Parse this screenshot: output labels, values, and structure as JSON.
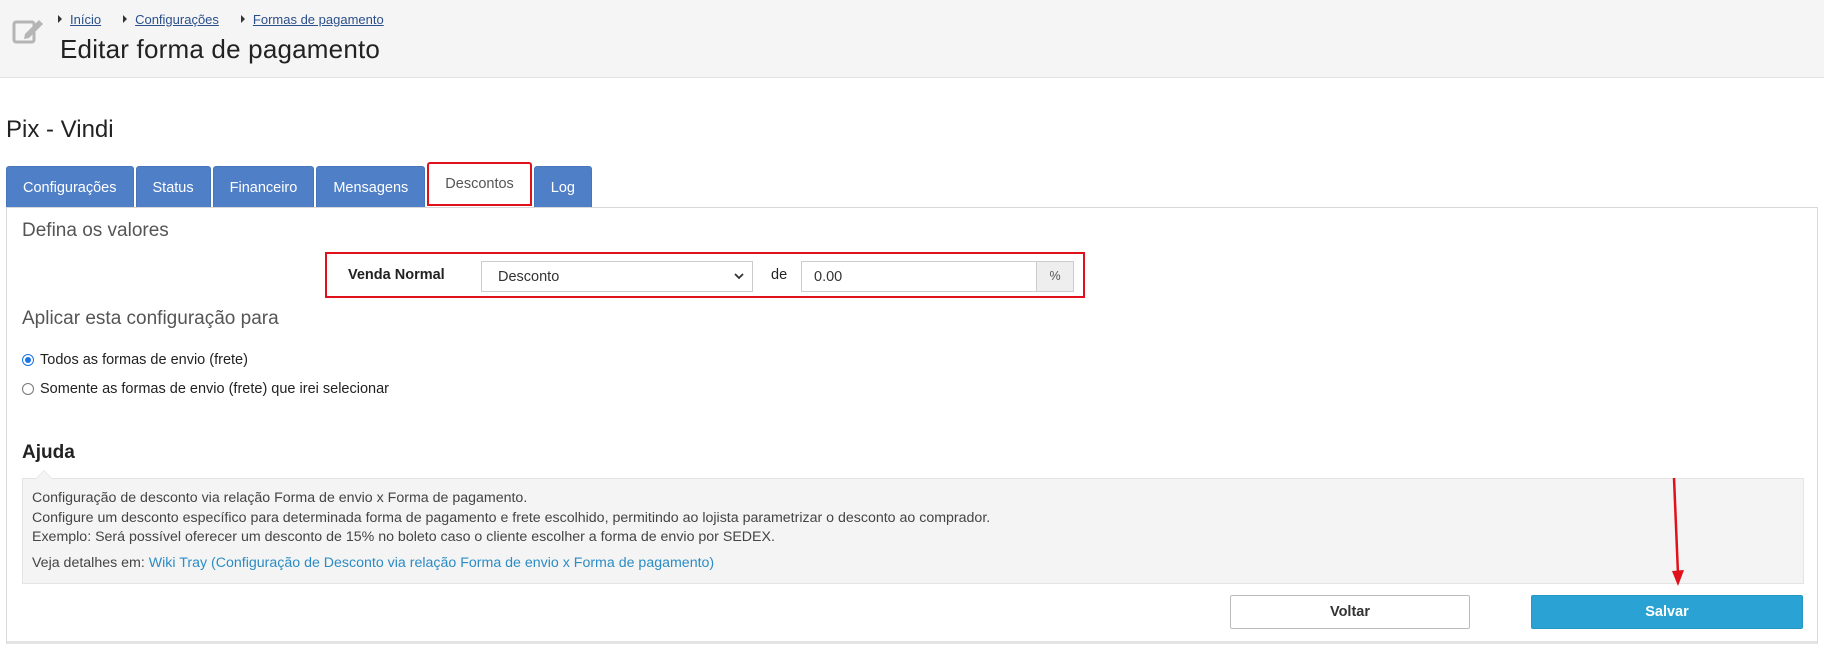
{
  "breadcrumb": {
    "items": [
      "Início",
      "Configurações",
      "Formas de pagamento"
    ]
  },
  "header": {
    "title": "Editar forma de pagamento"
  },
  "record": {
    "title": "Pix - Vindi"
  },
  "tabs": [
    {
      "label": "Configurações",
      "active": false
    },
    {
      "label": "Status",
      "active": false
    },
    {
      "label": "Financeiro",
      "active": false
    },
    {
      "label": "Mensagens",
      "active": false
    },
    {
      "label": "Descontos",
      "active": true
    },
    {
      "label": "Log",
      "active": false
    }
  ],
  "values_section": {
    "heading": "Defina os valores",
    "row_label": "Venda Normal",
    "select_value": "Desconto",
    "connector": "de",
    "amount_value": "0.00",
    "unit": "%"
  },
  "apply_section": {
    "heading": "Aplicar esta configuração para",
    "options": [
      {
        "label": "Todos as formas de envio (frete)",
        "checked": true
      },
      {
        "label": "Somente as formas de envio (frete) que irei selecionar",
        "checked": false
      }
    ]
  },
  "help": {
    "title": "Ajuda",
    "lines": [
      "Configuração de desconto via relação Forma de envio x Forma de pagamento.",
      "Configure um desconto específico para determinada forma de pagamento e frete escolhido, permitindo ao lojista parametrizar o desconto ao comprador.",
      "Exemplo: Será possível oferecer um desconto de 15% no boleto caso o cliente escolher a forma de envio por SEDEX."
    ],
    "details_prefix": "Veja detalhes em:",
    "details_link": "Wiki Tray (Configuração de Desconto via relação Forma de envio x Forma de pagamento)"
  },
  "actions": {
    "back_label": "Voltar",
    "save_label": "Salvar"
  },
  "colors": {
    "tab_blue": "#4f7fc7",
    "highlight_red": "#e0111b",
    "save_blue": "#2aa3d4",
    "link_blue": "#2b8cc4"
  },
  "icons": {
    "header": "edit-icon",
    "breadcrumb_separator": "caret-right-icon",
    "select": "chevron-down-icon",
    "annotation": "red-arrow-icon"
  }
}
